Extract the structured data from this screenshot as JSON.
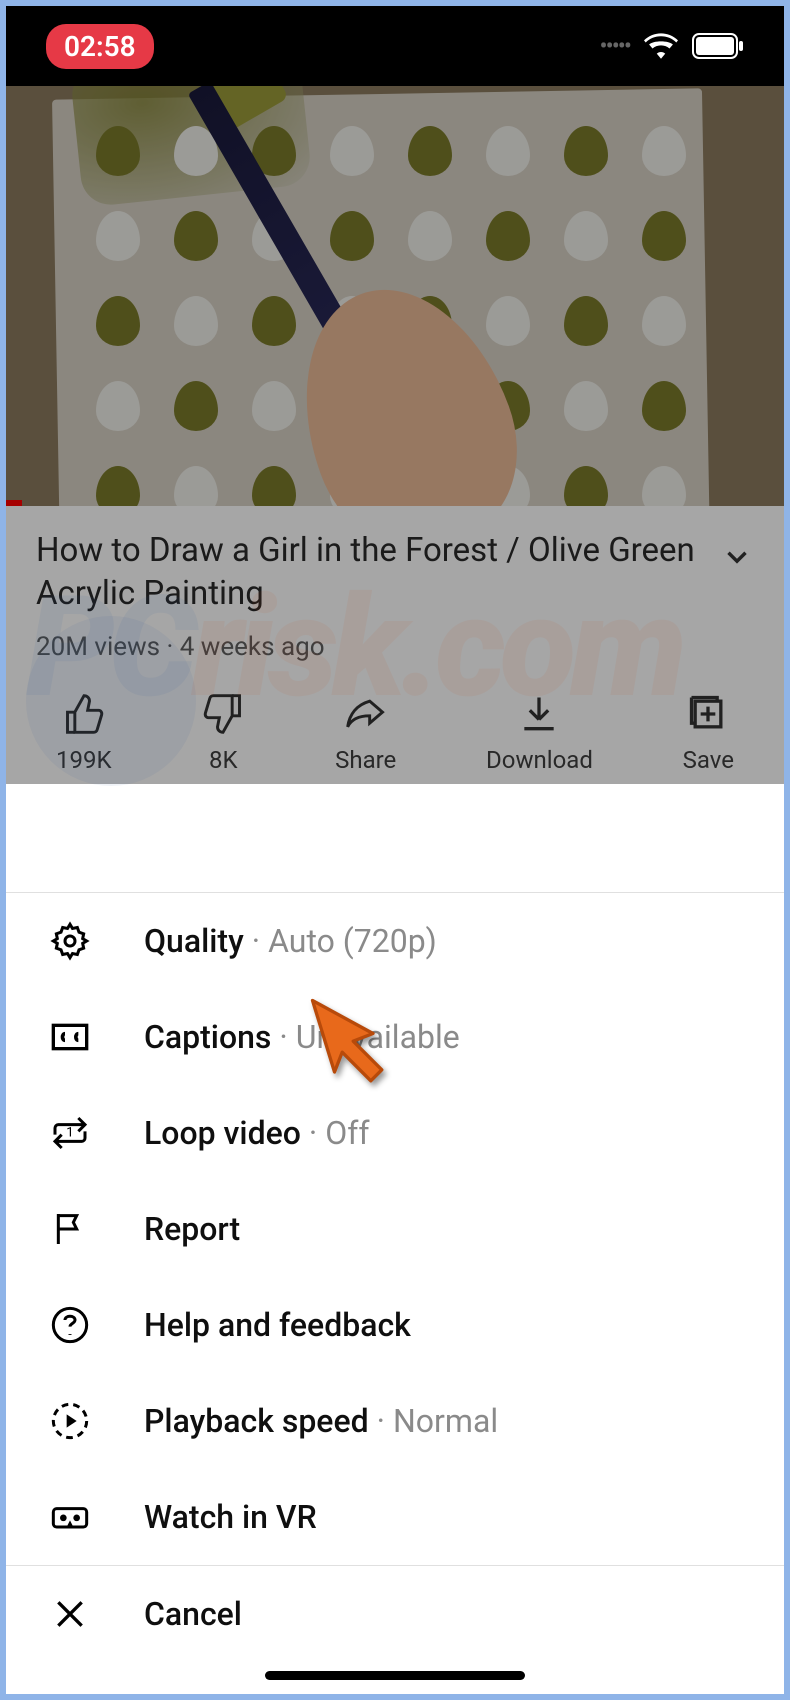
{
  "statusbar": {
    "time": "02:58"
  },
  "video": {
    "title": "How to Draw a Girl in the Forest / Olive Green Acrylic Painting",
    "views": "20M views",
    "age": "4 weeks ago",
    "actions": {
      "like": {
        "count": "199K"
      },
      "dislike": {
        "count": "8K"
      },
      "share": {
        "label": "Share"
      },
      "download": {
        "label": "Download"
      },
      "save": {
        "label": "Save"
      }
    }
  },
  "menu": {
    "quality": {
      "label": "Quality",
      "value": "Auto (720p)"
    },
    "captions": {
      "label": "Captions",
      "value": "Unavailable"
    },
    "loop": {
      "label": "Loop video",
      "value": "Off"
    },
    "report": {
      "label": "Report"
    },
    "help": {
      "label": "Help and feedback"
    },
    "speed": {
      "label": "Playback speed",
      "value": "Normal"
    },
    "vr": {
      "label": "Watch in VR"
    },
    "cancel": {
      "label": "Cancel"
    }
  },
  "watermark": {
    "pc": "PC",
    "risk": "risk.com"
  }
}
